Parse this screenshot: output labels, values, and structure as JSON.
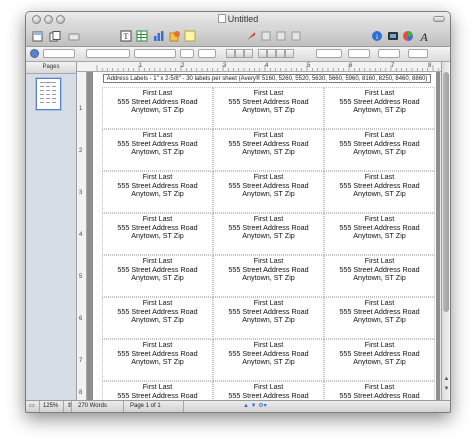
{
  "window": {
    "title": "Untitled"
  },
  "sidebar": {
    "header": "Pages"
  },
  "document": {
    "header_text": "Address Labels - 1\" x 2-5/8\" - 30 labels per sheet (Avery® 5160, 5260, 5520, 5630, 5660, 5960, 8160, 8250, 8460, 8860)",
    "label": {
      "line1": "First Last",
      "line2": "555 Street Address Road",
      "line3": "Anytown, ST Zip"
    },
    "visible_rows": 8,
    "columns": 3
  },
  "rulers": {
    "horizontal": [
      "1",
      "2",
      "3",
      "4",
      "5",
      "6",
      "7",
      "8"
    ],
    "vertical": [
      "1",
      "2",
      "3",
      "4",
      "5",
      "6",
      "7",
      "8"
    ]
  },
  "statusbar": {
    "zoom": "125%",
    "word_count": "270 Words",
    "page_indicator": "Page 1 of 1"
  },
  "icons": {
    "title": [
      "window-close-icon",
      "window-minimize-icon",
      "window-zoom-icon",
      "document-proxy-icon",
      "toolbar-toggle-icon"
    ],
    "toolbar_left": [
      "view-icon",
      "sections-icon",
      "undo-icon"
    ],
    "toolbar_center": [
      "text-box-icon",
      "table-icon",
      "chart-icon",
      "shapes-icon",
      "comment-icon"
    ],
    "toolbar_right": [
      "inspector-icon",
      "media-icon",
      "colors-icon",
      "fonts-icon"
    ]
  },
  "colors": {
    "page": "#ffffff",
    "canvas": "#8f8f8f",
    "sidebar": "#d7dde6",
    "selection": "#5b82c9"
  }
}
